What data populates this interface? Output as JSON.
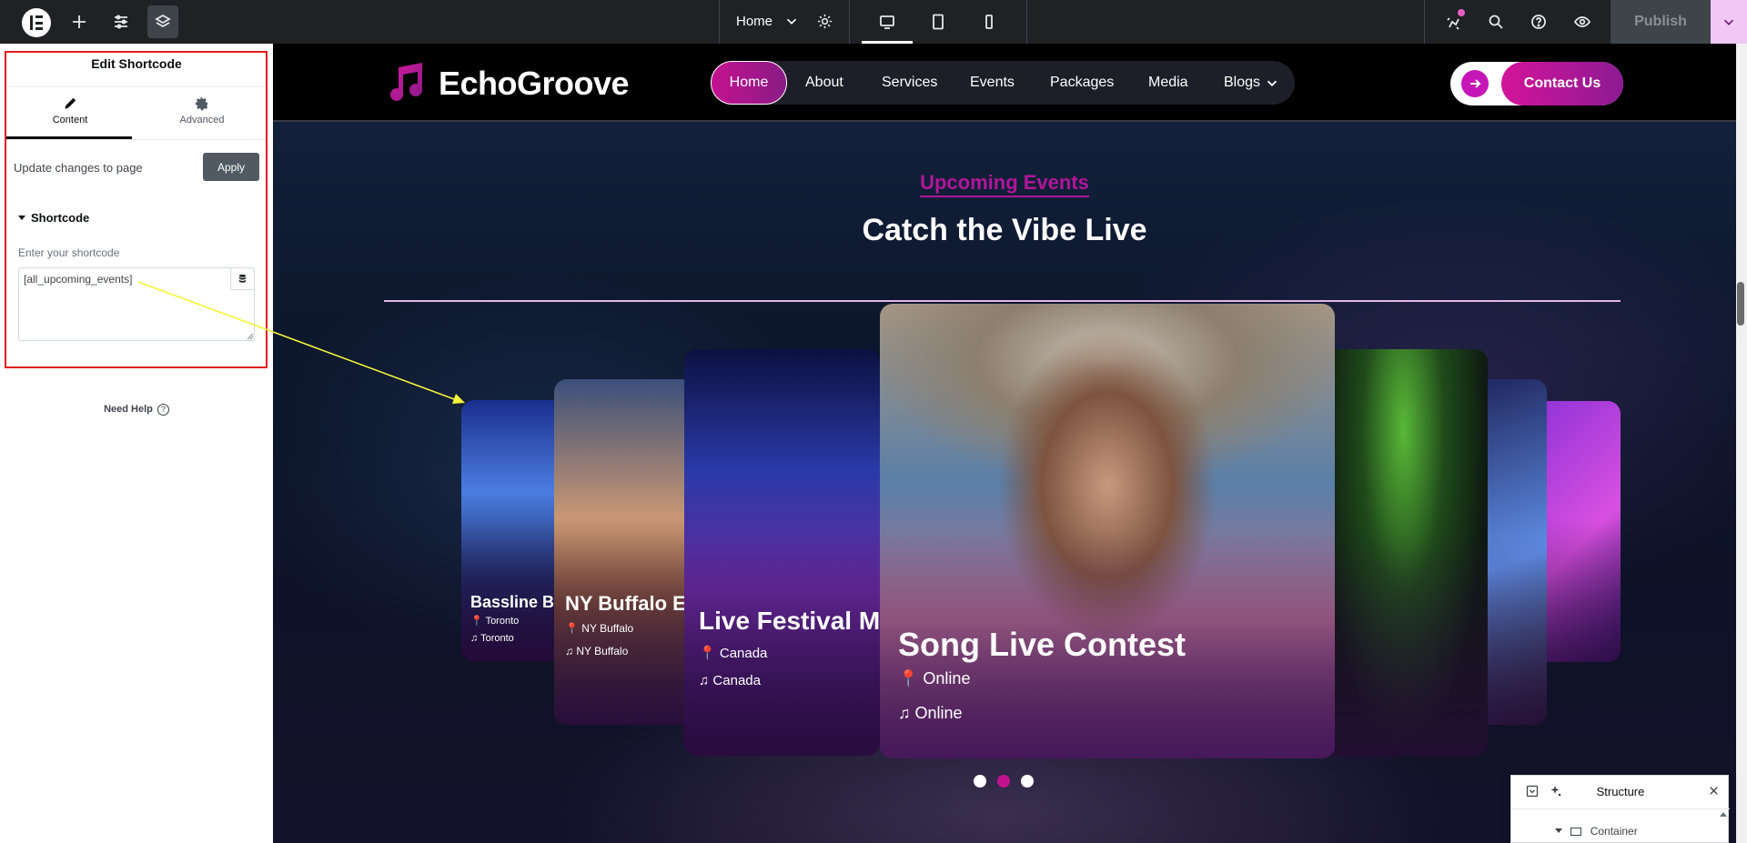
{
  "editor": {
    "page_name": "Home",
    "publish_label": "Publish"
  },
  "panel": {
    "title": "Edit Shortcode",
    "tabs": [
      {
        "label": "Content",
        "icon": "pencil-icon"
      },
      {
        "label": "Advanced",
        "icon": "gear-icon"
      }
    ],
    "update_label": "Update changes to page",
    "apply_label": "Apply",
    "section_title": "Shortcode",
    "field_label": "Enter your shortcode",
    "shortcode_value": "[all_upcoming_events]",
    "need_help": "Need Help"
  },
  "site": {
    "brand": "EchoGroove",
    "nav": [
      "Home",
      "About",
      "Services",
      "Events",
      "Packages",
      "Media",
      "Blogs"
    ],
    "contact_label": "Contact Us",
    "eyebrow": "Upcoming Events",
    "heading": "Catch the Vibe Live",
    "events": [
      {
        "title": "Bassline B",
        "location": "Toronto",
        "genre": "Toronto"
      },
      {
        "title": "NY Buffalo E",
        "location": "NY Buffalo",
        "genre": "NY Buffalo"
      },
      {
        "title": "Live Festival Mu",
        "location": "Canada",
        "genre": "Canada"
      },
      {
        "title": "Song Live Contest",
        "location": "Online",
        "genre": "Online"
      }
    ],
    "active_slide": 2
  },
  "structure": {
    "title": "Structure",
    "item": "Container"
  },
  "colors": {
    "accent_pink": "#c3128f",
    "annotation_red": "#e11b22",
    "annotation_arrow": "#f5f53a"
  }
}
